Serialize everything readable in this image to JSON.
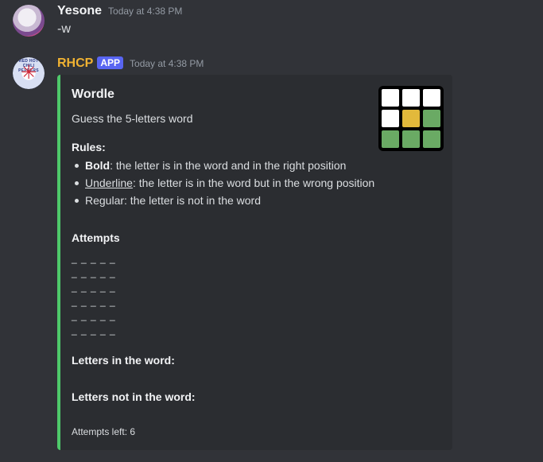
{
  "messages": [
    {
      "username": "Yesone",
      "timestamp": "Today at 4:38 PM",
      "content": "-w"
    },
    {
      "username": "RHCP",
      "badge": "APP",
      "timestamp": "Today at 4:38 PM",
      "avatar_text": "RED HOT CHILI PEPPERS"
    }
  ],
  "embed": {
    "accent_color": "#4ec96a",
    "title": "Wordle",
    "description": "Guess the 5-letters word",
    "rules_heading": "Rules:",
    "rules": [
      {
        "emph": "Bold",
        "text": ": the letter is in the word and in the right position"
      },
      {
        "emph": "Underline",
        "text": ": the letter is in the word but in the wrong position"
      },
      {
        "emph": "",
        "text": "Regular: the letter is not in the word"
      }
    ],
    "attempts_heading": "Attempts",
    "attempts": [
      "_ _ _ _ _",
      "_ _ _ _ _",
      "_ _ _ _ _",
      "_ _ _ _ _",
      "_ _ _ _ _",
      "_ _ _ _ _"
    ],
    "letters_in_heading": "Letters in the word:",
    "letters_not_in_heading": "Letters not in the word:",
    "footer": "Attempts left: 6",
    "thumbnail": {
      "icon": "wordle-grid-icon",
      "colors": [
        "#ffffff",
        "#ffffff",
        "#ffffff",
        "#ffffff",
        "#e2b93b",
        "#6aaa64",
        "#6aaa64",
        "#6aaa64",
        "#6aaa64"
      ]
    }
  }
}
